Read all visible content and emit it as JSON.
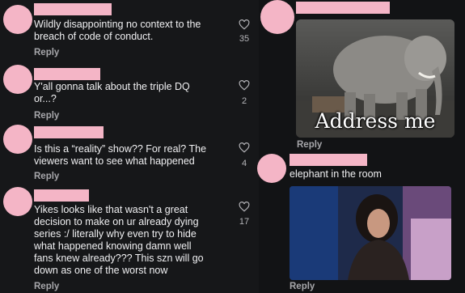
{
  "left_comments": [
    {
      "name_suffix": "",
      "text": "Wildly disappointing no context to the\nbreach of code of conduct.",
      "likes": "35",
      "reply": "Reply"
    },
    {
      "name_suffix": "",
      "text": "Y'all gonna talk about the triple DQ\nor...?",
      "likes": "2",
      "reply": "Reply"
    },
    {
      "name_suffix": "",
      "text": "Is this a “reality” show?? For real? The\nviewers want to see what happened",
      "likes": "4",
      "reply": "Reply"
    },
    {
      "name_suffix": "",
      "text": "Yikes looks like that wasn't a great\ndecision to make on ur already dying\nseries :/ literally why even try to hide\nwhat happened knowing damn well\nfans knew already??? This szn will go\ndown as one of the worst now",
      "likes": "17",
      "reply": "Reply"
    }
  ],
  "right_comments": [
    {
      "image_caption": "Address me",
      "reply": "Reply"
    },
    {
      "text": "elephant in the room",
      "reply": "Reply"
    }
  ],
  "colors": {
    "avatar": "#f4b5c6",
    "background": "#111214",
    "text": "#f0f0f2",
    "muted": "#a7a7ab"
  },
  "icons": {
    "like": "heart-outline-icon"
  }
}
